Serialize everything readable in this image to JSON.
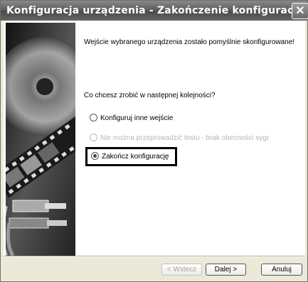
{
  "window": {
    "title": "Konfiguracja urządzenia - Zakończenie konfiguracji",
    "close_glyph": "✕"
  },
  "content": {
    "success_text": "Wejście wybranego urządzenia zostało pomyślnie skonfigurowane!",
    "question": "Co chcesz zrobić w następnej kolejności?",
    "options": [
      {
        "label": "Konfiguruj inne wejście",
        "selected": false,
        "enabled": true
      },
      {
        "label": "Nie można przeprowadzić testu - brak obecności sygr",
        "selected": false,
        "enabled": false
      },
      {
        "label": "Zakończ konfigurację",
        "selected": true,
        "enabled": true
      }
    ]
  },
  "buttons": {
    "back": "< Wstecz",
    "next": "Dalej >",
    "cancel": "Anuluj"
  },
  "icons": {
    "banner": "film-disc-usb-banner",
    "close": "close-icon"
  }
}
